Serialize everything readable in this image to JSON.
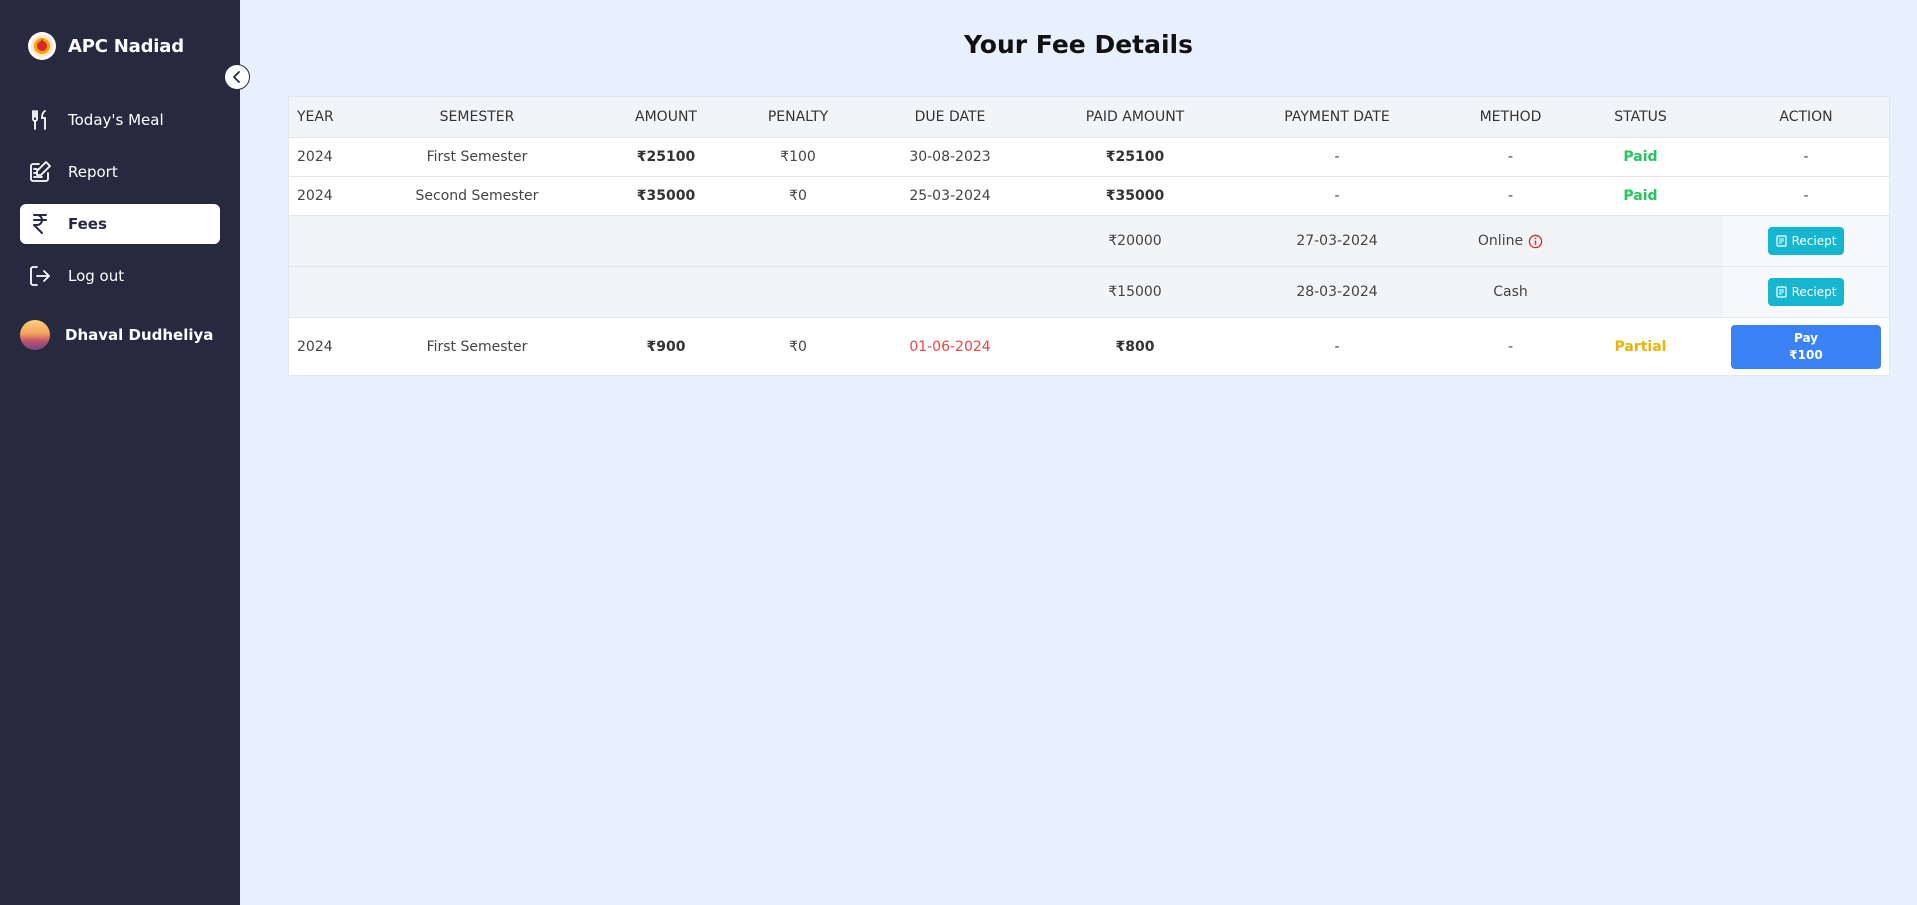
{
  "app": {
    "name": "APC Nadiad"
  },
  "sidebar": {
    "items": [
      {
        "label": "Today's Meal",
        "icon": "fork-knife-icon"
      },
      {
        "label": "Report",
        "icon": "edit-document-icon"
      },
      {
        "label": "Fees",
        "icon": "rupee-icon",
        "active": true
      },
      {
        "label": "Log out",
        "icon": "logout-icon"
      }
    ],
    "user": {
      "name": "Dhaval Dudheliya"
    }
  },
  "page": {
    "title": "Your Fee Details"
  },
  "table": {
    "headers": [
      "YEAR",
      "SEMESTER",
      "AMOUNT",
      "PENALTY",
      "DUE DATE",
      "PAID AMOUNT",
      "PAYMENT DATE",
      "METHOD",
      "STATUS",
      "ACTION"
    ],
    "rows": [
      {
        "year": "2024",
        "semester": "First Semester",
        "amount": "₹25100",
        "penalty": "₹100",
        "due_date": "30-08-2023",
        "paid_amount": "₹25100",
        "payment_date": "-",
        "method": "-",
        "status": "Paid",
        "action": "-"
      },
      {
        "year": "2024",
        "semester": "Second Semester",
        "amount": "₹35000",
        "penalty": "₹0",
        "due_date": "25-03-2024",
        "paid_amount": "₹35000",
        "payment_date": "-",
        "method": "-",
        "status": "Paid",
        "action": "-"
      }
    ],
    "payments": [
      {
        "paid_amount": "₹20000",
        "payment_date": "27-03-2024",
        "method": "Online",
        "action": "Reciept"
      },
      {
        "paid_amount": "₹15000",
        "payment_date": "28-03-2024",
        "method": "Cash",
        "action": "Reciept"
      }
    ],
    "last_row": {
      "year": "2024",
      "semester": "First Semester",
      "amount": "₹900",
      "penalty": "₹0",
      "due_date": "01-06-2024",
      "paid_amount": "₹800",
      "payment_date": "-",
      "method": "-",
      "status": "Partial",
      "pay_label": "Pay",
      "pay_amount": "₹100"
    }
  },
  "colors": {
    "sidebar": "#272a3f",
    "paid": "#22c55e",
    "partial": "#eab308",
    "overdue": "#ef4444",
    "receipt_button": "#17b6d0",
    "pay_button": "#3b82f6"
  }
}
